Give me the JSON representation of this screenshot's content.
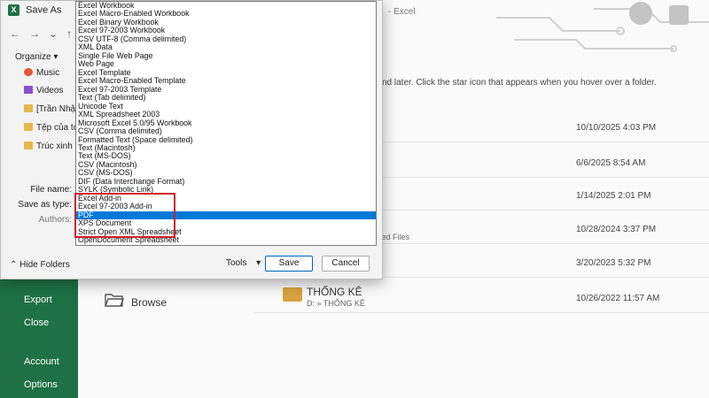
{
  "excel": {
    "top_title": "- Excel",
    "sidebar_items": [
      "Export",
      "Close",
      "Account",
      "Options"
    ],
    "info_text": "find later. Click the star icon that appears when you hover over a folder.",
    "recent_dates": [
      "10/10/2025 4:03 PM",
      "6/6/2025 8:54 AM",
      "1/14/2025 2:01 PM",
      "10/28/2024 3:37 PM",
      "3/20/2023 5:32 PM"
    ],
    "recent_sub": "ved Files",
    "folder": {
      "name": "THỐNG KÊ",
      "path": "D: » THỐNG KÊ",
      "date": "10/26/2022 11:57 AM"
    },
    "browse_label": "Browse"
  },
  "dialog": {
    "title": "Save As",
    "organize": "Organize ▾",
    "tree": [
      "Music",
      "Videos",
      "[Trần Nhật Vy",
      "Tệp của tơ",
      "Trúc xinh tốt"
    ],
    "file_name_label": "File name:",
    "save_type_label": "Save as type:",
    "authors_label": "Authors:",
    "hide_folders": "Hide Folders",
    "tools": "Tools",
    "save": "Save",
    "cancel": "Cancel",
    "types": [
      "Excel Workbook",
      "Excel Macro-Enabled Workbook",
      "Excel Binary Workbook",
      "Excel 97-2003 Workbook",
      "CSV UTF-8 (Comma delimited)",
      "XML Data",
      "Single File Web Page",
      "Web Page",
      "Excel Template",
      "Excel Macro-Enabled Template",
      "Excel 97-2003 Template",
      "Text (Tab delimited)",
      "Unicode Text",
      "XML Spreadsheet 2003",
      "Microsoft Excel 5.0/95 Workbook",
      "CSV (Comma delimited)",
      "Formatted Text (Space delimited)",
      "Text (Macintosh)",
      "Text (MS-DOS)",
      "CSV (Macintosh)",
      "CSV (MS-DOS)",
      "DIF (Data Interchange Format)",
      "SYLK (Symbolic Link)",
      "Excel Add-in",
      "Excel 97-2003 Add-in",
      "PDF",
      "XPS Document",
      "Strict Open XML Spreadsheet",
      "OpenDocument Spreadsheet"
    ],
    "selected_type": "PDF"
  },
  "colors": {
    "excel_green": "#1e7145",
    "selection_blue": "#0078d7",
    "highlight_red": "#d0202e"
  }
}
